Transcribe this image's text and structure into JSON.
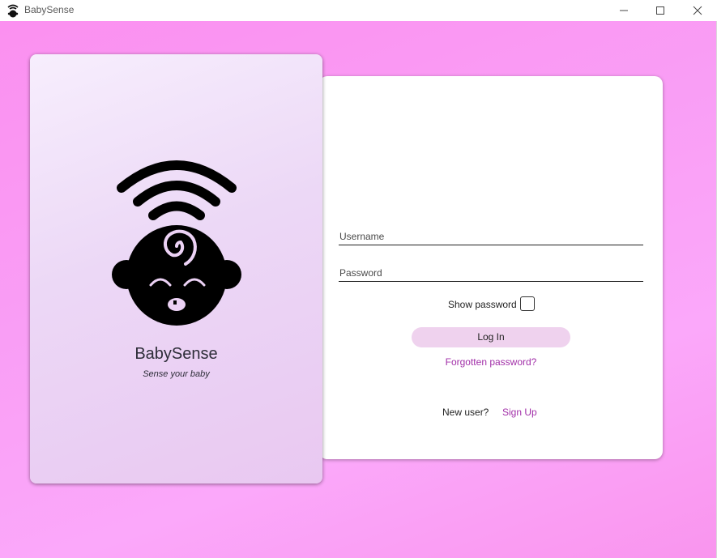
{
  "window": {
    "title": "BabySense",
    "icon": "baby-app-icon",
    "controls": [
      "minimize-icon",
      "maximize-icon",
      "close-icon"
    ]
  },
  "brand": {
    "name": "BabySense",
    "tagline": "Sense your baby",
    "logo": "baby-signal-logo"
  },
  "login": {
    "username_placeholder": "Username",
    "password_placeholder": "Password",
    "show_password_label": "Show password",
    "login_button": "Log In",
    "forgot_link": "Forgotten password?",
    "new_user_label": "New user?",
    "signup_link": "Sign Up"
  },
  "colors": {
    "background": "#fb9cf3",
    "accent_link": "#a12ea8",
    "button_bg": "#efd2ee"
  }
}
